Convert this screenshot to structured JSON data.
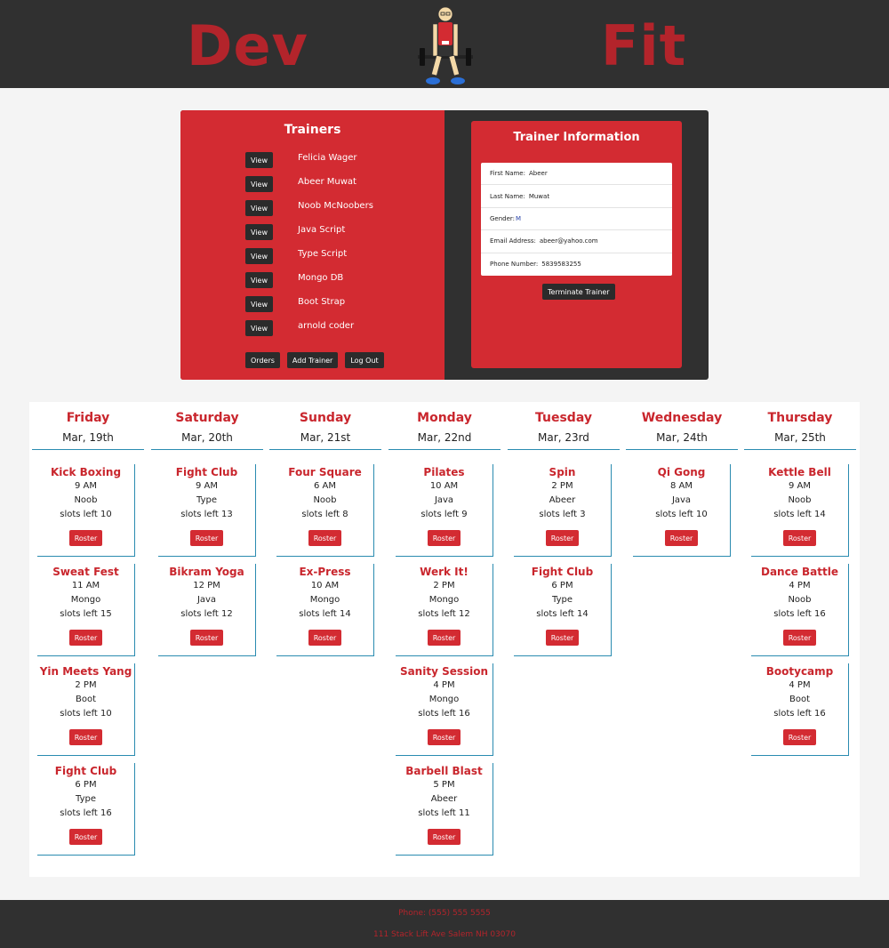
{
  "header": {
    "brand_left": "Dev",
    "brand_right": "Fit",
    "logo_icon": "weightlifter-logo"
  },
  "trainers_panel": {
    "title": "Trainers",
    "view_label": "View",
    "trainers": [
      "Felicia Wager",
      "Abeer Muwat",
      "Noob McNoobers",
      "Java Script",
      "Type Script",
      "Mongo DB",
      "Boot Strap",
      "arnold coder"
    ],
    "orders_label": "Orders",
    "add_trainer_label": "Add Trainer",
    "logout_label": "Log Out"
  },
  "trainer_info": {
    "title": "Trainer Information",
    "first_name_label": "First Name:",
    "first_name": "Abeer",
    "last_name_label": "Last Name:",
    "last_name": "Muwat",
    "gender_label": "Gender:",
    "gender": "M",
    "email_label": "Email Address:",
    "email": "abeer@yahoo.com",
    "phone_label": "Phone Number:",
    "phone": "5839583255",
    "terminate_label": "Terminate Trainer"
  },
  "schedule": {
    "roster_label": "Roster",
    "days": [
      {
        "name": "Friday",
        "date": "Mar, 19th",
        "classes": [
          {
            "title": "Kick Boxing",
            "time": "9 AM",
            "trainer": "Noob",
            "slots": "slots left 10"
          },
          {
            "title": "Sweat Fest",
            "time": "11 AM",
            "trainer": "Mongo",
            "slots": "slots left 15"
          },
          {
            "title": "Yin Meets Yang",
            "time": "2 PM",
            "trainer": "Boot",
            "slots": "slots left 10"
          },
          {
            "title": "Fight Club",
            "time": "6 PM",
            "trainer": "Type",
            "slots": "slots left 16"
          }
        ]
      },
      {
        "name": "Saturday",
        "date": "Mar, 20th",
        "classes": [
          {
            "title": "Fight Club",
            "time": "9 AM",
            "trainer": "Type",
            "slots": "slots left 13"
          },
          {
            "title": "Bikram Yoga",
            "time": "12 PM",
            "trainer": "Java",
            "slots": "slots left 12"
          }
        ]
      },
      {
        "name": "Sunday",
        "date": "Mar, 21st",
        "classes": [
          {
            "title": "Four Square",
            "time": "6 AM",
            "trainer": "Noob",
            "slots": "slots left 8"
          },
          {
            "title": "Ex-Press",
            "time": "10 AM",
            "trainer": "Mongo",
            "slots": "slots left 14"
          }
        ]
      },
      {
        "name": "Monday",
        "date": "Mar, 22nd",
        "classes": [
          {
            "title": "Pilates",
            "time": "10 AM",
            "trainer": "Java",
            "slots": "slots left 9"
          },
          {
            "title": "Werk It!",
            "time": "2 PM",
            "trainer": "Mongo",
            "slots": "slots left 12"
          },
          {
            "title": "Sanity Session",
            "time": "4 PM",
            "trainer": "Mongo",
            "slots": "slots left 16"
          },
          {
            "title": "Barbell Blast",
            "time": "5 PM",
            "trainer": "Abeer",
            "slots": "slots left 11"
          }
        ]
      },
      {
        "name": "Tuesday",
        "date": "Mar, 23rd",
        "classes": [
          {
            "title": "Spin",
            "time": "2 PM",
            "trainer": "Abeer",
            "slots": "slots left 3"
          },
          {
            "title": "Fight Club",
            "time": "6 PM",
            "trainer": "Type",
            "slots": "slots left 14"
          }
        ]
      },
      {
        "name": "Wednesday",
        "date": "Mar, 24th",
        "classes": [
          {
            "title": "Qi Gong",
            "time": "8 AM",
            "trainer": "Java",
            "slots": "slots left 10"
          }
        ]
      },
      {
        "name": "Thursday",
        "date": "Mar, 25th",
        "classes": [
          {
            "title": "Kettle Bell",
            "time": "9 AM",
            "trainer": "Noob",
            "slots": "slots left 14"
          },
          {
            "title": "Dance Battle",
            "time": "4 PM",
            "trainer": "Noob",
            "slots": "slots left 16"
          },
          {
            "title": "Bootycamp",
            "time": "4 PM",
            "trainer": "Boot",
            "slots": "slots left 16"
          }
        ]
      }
    ]
  },
  "footer": {
    "phone": "Phone: (555) 555 5555",
    "address": "111 Stack Lift Ave Salem NH 03070"
  },
  "colors": {
    "brand_red": "#d32b32",
    "dark": "#303030",
    "accent_blue": "#2a8bb0"
  }
}
